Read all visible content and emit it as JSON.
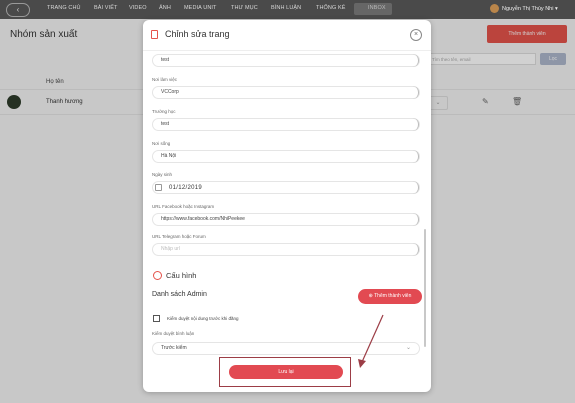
{
  "nav": {
    "items": [
      "TRANG CHỦ",
      "BÀI VIẾT",
      "VIDEO",
      "ẢNH",
      "MEDIA UNIT",
      "THƯ MỤC",
      "BÌNH LUẬN",
      "THỐNG KÊ"
    ],
    "inbox": "INBOX",
    "user": "Nguyễn Thị Thùy Nhi"
  },
  "page": {
    "title": "Nhóm sản xuất",
    "add_member": "Thêm thành viên",
    "search_placeholder": "Tìm theo tên, email",
    "search_button": "Lọc",
    "col_name": "Họ tên",
    "row_name": "Thanh hương"
  },
  "modal": {
    "title": "Chỉnh sửa trang",
    "fields": [
      {
        "label": "",
        "value": "test"
      },
      {
        "label": "Nơi làm việc",
        "value": "VCCorp"
      },
      {
        "label": "Trường học",
        "value": "test"
      },
      {
        "label": "Nơi sống",
        "value": "Hà Nội"
      },
      {
        "label": "Ngày sinh",
        "value": "01/12/2019"
      },
      {
        "label": "URL Facebook hoặc Instagram",
        "value": "https://www.facebook.com/NhiPeekee"
      },
      {
        "label": "URL Telegram hoặc Forum",
        "value": "Nhập url"
      }
    ],
    "config_title": "Cấu hình",
    "admin_list": "Danh sách Admin",
    "add_member_button": "Thêm thành viên",
    "checkbox_label": "Kiểm duyệt nội dung trước khi đăng",
    "review_label": "Kiểm duyệt bình luận",
    "review_value": "Trước kiểm",
    "save_button": "Lưu lại"
  }
}
